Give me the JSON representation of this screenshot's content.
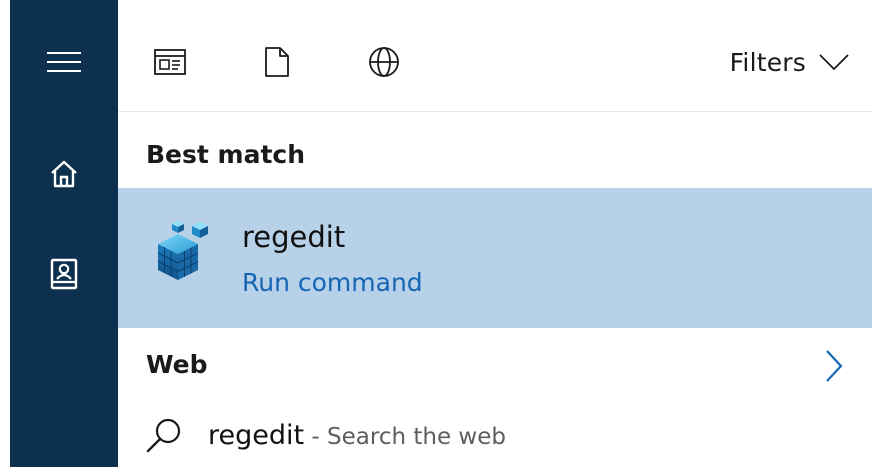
{
  "toolbar": {
    "filters_label": "Filters",
    "icons": [
      "apps-icon",
      "document-icon",
      "web-globe-icon"
    ]
  },
  "sections": {
    "best_match_heading": "Best match",
    "web_heading": "Web"
  },
  "best_match": {
    "title": "regedit",
    "subtitle": "Run command"
  },
  "web_search": {
    "query": "regedit",
    "separator": " - ",
    "suffix": "Search the web"
  },
  "colors": {
    "sidebar": "#0d304f",
    "selected_row": "#b6d1e8",
    "link_blue": "#1565b5",
    "chevron_blue": "#1565b5"
  }
}
